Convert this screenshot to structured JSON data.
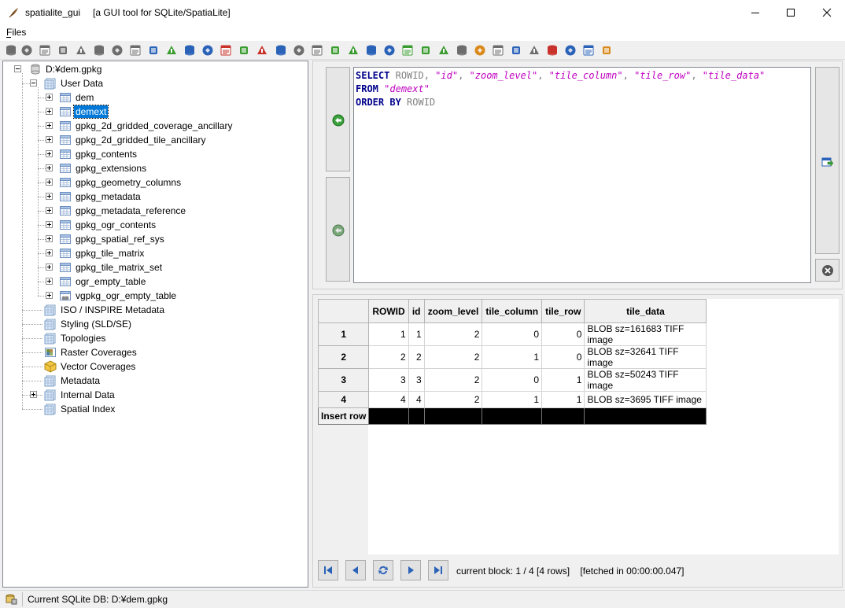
{
  "window": {
    "app_name": "spatialite_gui",
    "subtitle": "[a GUI tool for SQLite/SpatiaLite]",
    "controls": [
      "minimize-icon",
      "maximize-icon",
      "close-icon"
    ]
  },
  "menu": {
    "files_label": "Files"
  },
  "toolbar": {
    "icons": [
      "connect-icon",
      "create-db-icon",
      "disconnect-icon",
      "memory-db-icon",
      "vacuum-icon",
      "sql-script-icon",
      "sql-log-icon",
      "load-shp-icon",
      "virtual-shp-icon",
      "virtual-csv-icon",
      "virtual-dbf-icon",
      "load-dbf-icon",
      "load-xl-icon",
      "network-icon",
      "exif-icon",
      "gps-icon",
      "srid-icon",
      "charset-icon",
      "check-geometry-icon",
      "sanitize-icon",
      "attach-db-icon",
      "detach-db-icon",
      "load-dxf-icon",
      "dump-dxf-icon",
      "load-wfs-icon",
      "export-icon",
      "import-icon",
      "query-composer-icon",
      "map-icon",
      "style-icon",
      "wms-icon",
      "help-icon",
      "about-icon",
      "exit-icon"
    ],
    "colors": {
      "green": "#3a9b2f",
      "blue": "#2a62b8",
      "gray": "#6d6d6d",
      "orange": "#d98a1c",
      "red": "#c8322a"
    }
  },
  "tree": {
    "root": "D:¥dem.gpkg",
    "user_data": "User Data",
    "tables": [
      "dem",
      "demext",
      "gpkg_2d_gridded_coverage_ancillary",
      "gpkg_2d_gridded_tile_ancillary",
      "gpkg_contents",
      "gpkg_extensions",
      "gpkg_geometry_columns",
      "gpkg_metadata",
      "gpkg_metadata_reference",
      "gpkg_ogr_contents",
      "gpkg_spatial_ref_sys",
      "gpkg_tile_matrix",
      "gpkg_tile_matrix_set",
      "ogr_empty_table",
      "vgpkg_ogr_empty_table"
    ],
    "selected_table": "demext",
    "groups": [
      "ISO / INSPIRE Metadata",
      "Styling (SLD/SE)",
      "Topologies",
      "Raster Coverages",
      "Vector Coverages",
      "Metadata",
      "Internal Data",
      "Spatial Index"
    ]
  },
  "sql": {
    "line1": {
      "kw": "SELECT",
      "rowid": "ROWID",
      "cols": [
        "\"id\"",
        "\"zoom_level\"",
        "\"tile_column\"",
        "\"tile_row\"",
        "\"tile_data\""
      ]
    },
    "line2": {
      "kw": "FROM",
      "table": "\"demext\""
    },
    "line3": {
      "kw": "ORDER BY",
      "col": "ROWID"
    }
  },
  "grid": {
    "columns": [
      "ROWID",
      "id",
      "zoom_level",
      "tile_column",
      "tile_row",
      "tile_data"
    ],
    "rows": [
      {
        "num": "1",
        "cells": [
          "1",
          "1",
          "2",
          "0",
          "0",
          "BLOB sz=161683 TIFF image"
        ]
      },
      {
        "num": "2",
        "cells": [
          "2",
          "2",
          "2",
          "1",
          "0",
          "BLOB sz=32641 TIFF image"
        ]
      },
      {
        "num": "3",
        "cells": [
          "3",
          "3",
          "2",
          "0",
          "1",
          "BLOB sz=50243 TIFF image"
        ]
      },
      {
        "num": "4",
        "cells": [
          "4",
          "4",
          "2",
          "1",
          "1",
          "BLOB sz=3695 TIFF image"
        ]
      }
    ],
    "insert_row_label": "Insert row"
  },
  "nav": {
    "status": "current block: 1 / 4 [4 rows]    [fetched in 00:00:00.047]"
  },
  "statusbar": {
    "text": "Current SQLite DB: D:¥dem.gpkg"
  }
}
